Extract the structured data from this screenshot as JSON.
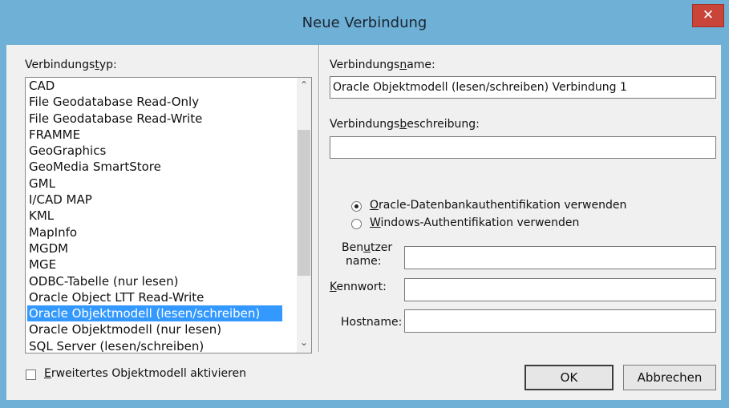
{
  "window": {
    "title": "Neue Verbindung",
    "close_glyph": "✕"
  },
  "conn_type": {
    "label_pre": "Verbindungs",
    "label_ul": "t",
    "label_post": "yp:",
    "items": [
      "CAD",
      "File Geodatabase Read-Only",
      "File Geodatabase Read-Write",
      "FRAMME",
      "GeoGraphics",
      "GeoMedia SmartStore",
      "GML",
      "I/CAD MAP",
      "KML",
      "MapInfo",
      "MGDM",
      "MGE",
      "ODBC-Tabelle (nur lesen)",
      "Oracle Object LTT Read-Write",
      "Oracle Objektmodell (lesen/schreiben)",
      "Oracle Objektmodell (nur lesen)",
      "SQL Server (lesen/schreiben)"
    ],
    "selected_index": 14,
    "scroll_up_glyph": "⌃",
    "scroll_down_glyph": "⌄"
  },
  "conn_name": {
    "label_pre": "Verbindungs",
    "label_ul": "n",
    "label_post": "ame:",
    "value": "Oracle Objektmodell (lesen/schreiben) Verbindung 1"
  },
  "conn_desc": {
    "label_pre": "Verbindungs",
    "label_ul": "b",
    "label_post": "eschreibung:",
    "value": ""
  },
  "auth": {
    "oracle_ul": "O",
    "oracle_rest": "racle-Datenbankauthentifikation verwenden",
    "windows_ul": "W",
    "windows_rest": "indows-Authentifikation verwenden",
    "oracle_selected": true
  },
  "user": {
    "label_line1_pre": "Ben",
    "label_line1_ul": "u",
    "label_line1_post": "tzer",
    "label_line2": "name:",
    "value": ""
  },
  "password": {
    "label_ul": "K",
    "label_rest": "ennwort:",
    "value": ""
  },
  "host": {
    "label": "Hostname:",
    "value": ""
  },
  "extended": {
    "label_ul": "E",
    "label_rest": "rweitertes Objektmodell aktivieren",
    "checked": false
  },
  "buttons": {
    "ok": "OK",
    "cancel": "Abbrechen"
  }
}
